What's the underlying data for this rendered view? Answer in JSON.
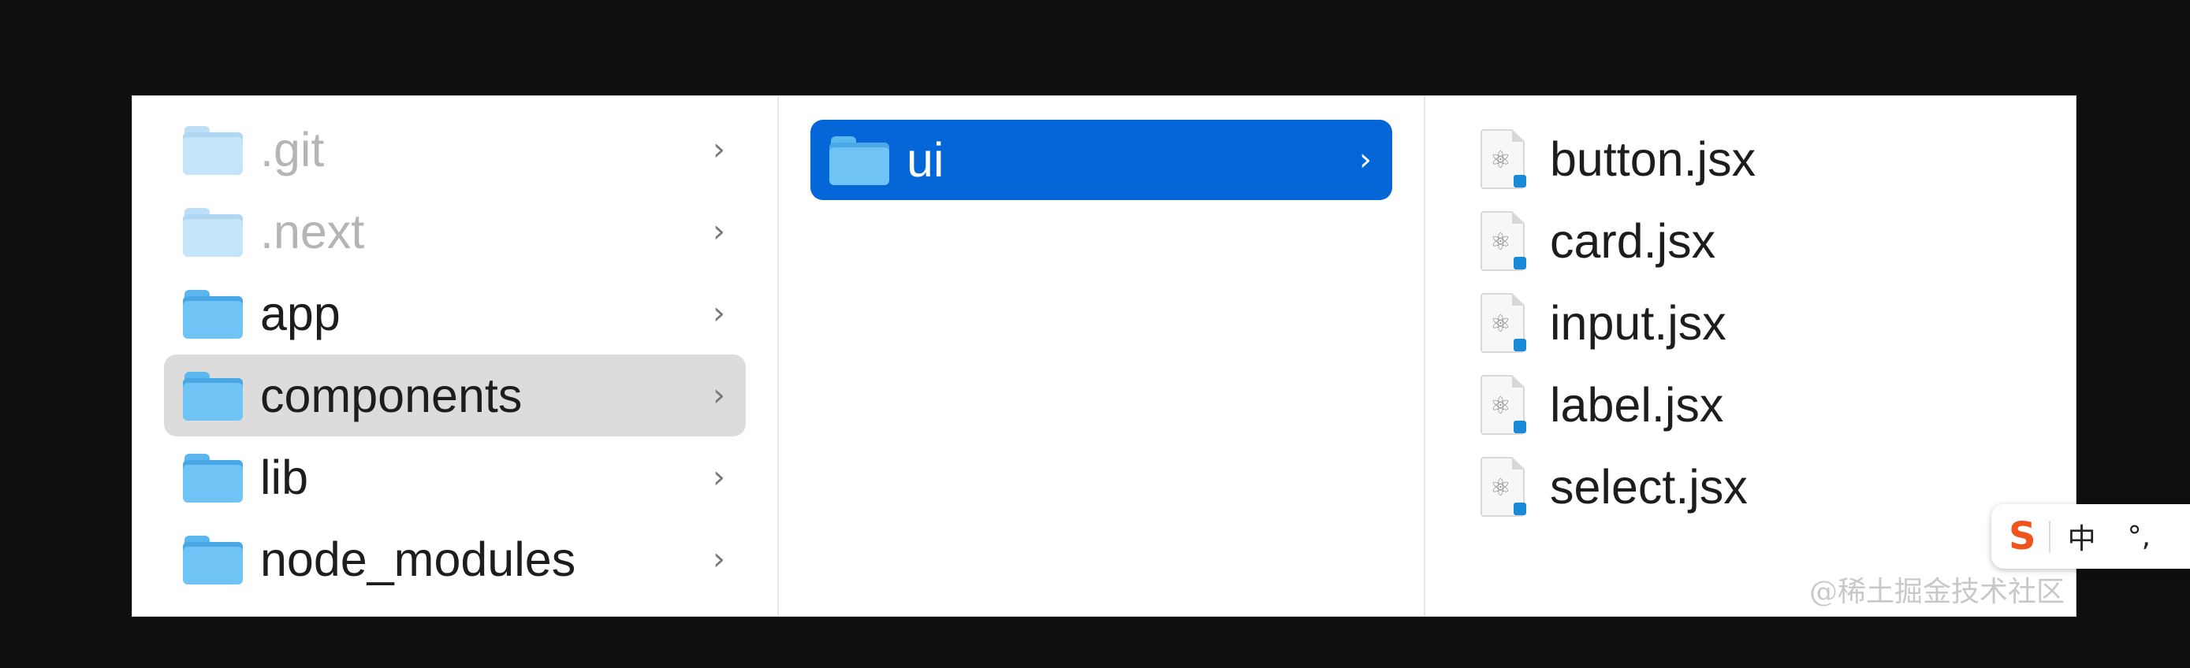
{
  "column1": {
    "items": [
      {
        "label": ".git",
        "faded": true
      },
      {
        "label": ".next",
        "faded": true
      },
      {
        "label": "app",
        "faded": false
      },
      {
        "label": "components",
        "faded": false,
        "selected": true
      },
      {
        "label": "lib",
        "faded": false
      },
      {
        "label": "node_modules",
        "faded": false
      }
    ]
  },
  "column2": {
    "items": [
      {
        "label": "ui",
        "selected": true
      }
    ]
  },
  "column3": {
    "files": [
      {
        "label": "button.jsx",
        "icon": "react-file-icon"
      },
      {
        "label": "card.jsx",
        "icon": "react-file-icon"
      },
      {
        "label": "input.jsx",
        "icon": "react-file-icon"
      },
      {
        "label": "label.jsx",
        "icon": "react-file-icon"
      },
      {
        "label": "select.jsx",
        "icon": "react-file-icon"
      }
    ]
  },
  "chevron": "›",
  "watermark": "@稀土掘金技术社区",
  "ime": {
    "logo": "S",
    "mode": "中",
    "punct": "°,"
  },
  "colors": {
    "selection_blue": "#0566d8",
    "selection_gray": "#dcdcdc",
    "folder_blue": "#6fc3f5"
  }
}
